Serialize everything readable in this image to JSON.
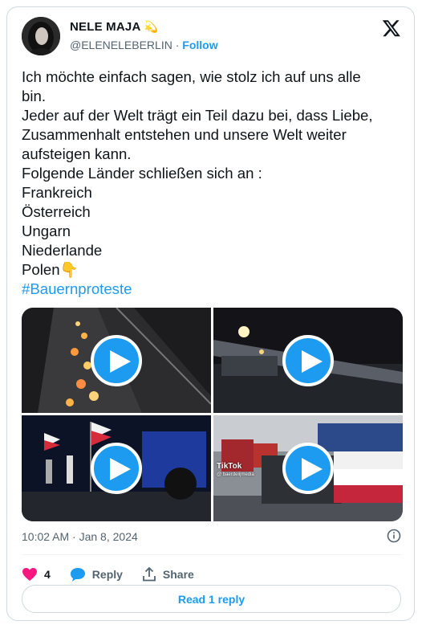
{
  "author": {
    "name": "NELE MAJA",
    "badge_icon": "shooting-star-emoji",
    "handle": "@ELENELEBERLIN",
    "separator": "·",
    "follow_label": "Follow"
  },
  "platform_icon": "x-logo-icon",
  "tweet": {
    "lines": [
      "Ich möchte einfach sagen, wie stolz ich auf uns alle",
      "bin.",
      "Jeder auf der Welt trägt ein Teil dazu bei, dass Liebe,",
      "Zusammenhalt entstehen und unsere Welt weiter",
      "aufsteigen kann.",
      "Folgende Länder schließen sich an :",
      "Frankreich",
      "Österreich",
      "Ungarn",
      "Niederlande",
      "Polen"
    ],
    "pointing_emoji": "👇",
    "hashtag": "#Bauernproteste"
  },
  "media": {
    "videos": [
      {
        "name": "video-highway-traffic-night"
      },
      {
        "name": "video-tractors-bridge-night"
      },
      {
        "name": "video-flags-tractor-night"
      },
      {
        "name": "video-tractors-tricolor-flag"
      }
    ],
    "tiktok_watermark": "TikTok",
    "tiktok_user": "@ baerdeiijmedia"
  },
  "timestamp": "10:02 AM · Jan 8, 2024",
  "actions": {
    "like_count": "4",
    "reply_label": "Reply",
    "share_label": "Share"
  },
  "read_reply_label": "Read 1 reply",
  "colors": {
    "accent": "#1d9bf0",
    "like": "#f91880",
    "text": "#0f1419",
    "muted": "#536471"
  }
}
